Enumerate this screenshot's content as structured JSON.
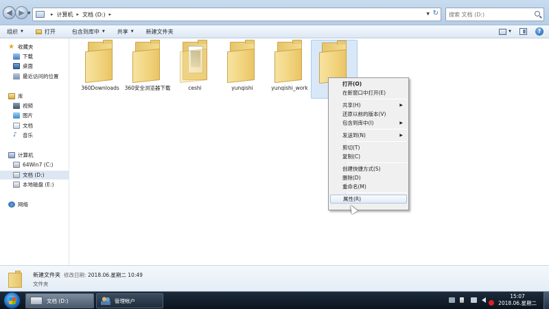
{
  "address": {
    "crumbs": [
      "计算机",
      "文档 (D:)"
    ],
    "separator": "▸",
    "search_placeholder": "搜索 文档 (D:)"
  },
  "toolbar": {
    "organize": "组织",
    "open": "打开",
    "include_in_library": "包含到库中",
    "share": "共享",
    "new_folder": "新建文件夹",
    "help": "?"
  },
  "nav": {
    "favorites": "收藏夹",
    "downloads": "下载",
    "desktop": "桌面",
    "recent": "最近访问的位置",
    "libraries": "库",
    "videos": "视频",
    "pictures": "图片",
    "documents": "文档",
    "music": "音乐",
    "computer": "计算机",
    "drive_c": "64Win7  (C:)",
    "drive_d": "文档 (D:)",
    "drive_e": "本地磁盘 (E:)",
    "network": "网络"
  },
  "files": [
    {
      "name": "360Downloads"
    },
    {
      "name": "360安全浏览器下载"
    },
    {
      "name": "ceshi"
    },
    {
      "name": "yunqishi"
    },
    {
      "name": "yunqishi_work"
    },
    {
      "name": "新"
    }
  ],
  "context_menu": {
    "open": "打开(O)",
    "open_new_window": "在新窗口中打开(E)",
    "share": "共享(H)",
    "restore_previous": "还原以前的版本(V)",
    "include_library": "包含到库中(I)",
    "send_to": "发送到(N)",
    "cut": "剪切(T)",
    "copy": "复制(C)",
    "create_shortcut": "创建快捷方式(S)",
    "delete": "删除(D)",
    "rename": "重命名(M)",
    "properties": "属性(R)"
  },
  "details": {
    "name": "新建文件夹",
    "modified_label": "修改日期:",
    "modified_value": "2018.06.星期二 10:49",
    "type": "文件夹"
  },
  "taskbar": {
    "task_explorer": "文档 (D:)",
    "task_accounts": "管理帐户",
    "time": "15:07",
    "date": "2018.06.星期二"
  }
}
